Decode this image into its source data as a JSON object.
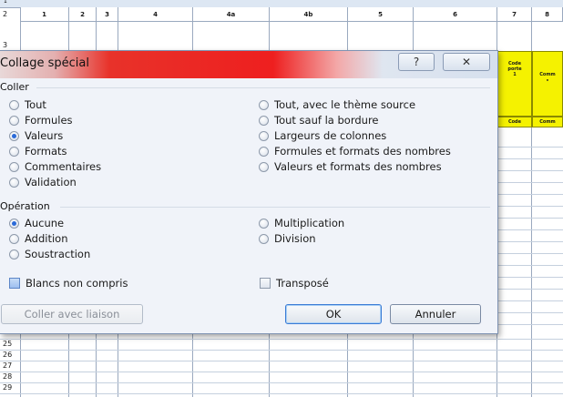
{
  "sheet": {
    "top_row_number": "1",
    "row_numbers_top": [
      "2",
      "3"
    ],
    "column_headers": [
      "1",
      "2",
      "3",
      "4",
      "4a",
      "4b",
      "5",
      "6",
      "7",
      "8"
    ],
    "row_numbers_bottom": [
      "25",
      "26",
      "27",
      "28",
      "29"
    ],
    "yellow_cells": [
      "Code\nporte\n1",
      "Comm\n•",
      "Code",
      "Comm"
    ]
  },
  "dialog": {
    "title": "Collage spécial",
    "help_button": "?",
    "close_button": "✕",
    "paste_section": {
      "label": "Coller",
      "left_options": [
        {
          "label": "Tout",
          "selected": false
        },
        {
          "label": "Formules",
          "selected": false
        },
        {
          "label": "Valeurs",
          "selected": true
        },
        {
          "label": "Formats",
          "selected": false
        },
        {
          "label": "Commentaires",
          "selected": false
        },
        {
          "label": "Validation",
          "selected": false
        }
      ],
      "right_options": [
        {
          "label": "Tout, avec le thème source",
          "selected": false
        },
        {
          "label": "Tout sauf la bordure",
          "selected": false
        },
        {
          "label": "Largeurs de colonnes",
          "selected": false
        },
        {
          "label": "Formules et formats des nombres",
          "selected": false
        },
        {
          "label": "Valeurs et formats des nombres",
          "selected": false
        }
      ]
    },
    "operation_section": {
      "label": "Opération",
      "left_options": [
        {
          "label": "Aucune",
          "selected": true
        },
        {
          "label": "Addition",
          "selected": false
        },
        {
          "label": "Soustraction",
          "selected": false
        }
      ],
      "right_options": [
        {
          "label": "Multiplication",
          "selected": false
        },
        {
          "label": "Division",
          "selected": false
        }
      ]
    },
    "checkboxes": {
      "skip_blanks": {
        "label": "Blancs non compris",
        "checked": false
      },
      "transpose": {
        "label": "Transposé",
        "checked": false
      }
    },
    "buttons": {
      "paste_link": "Coller avec liaison",
      "ok": "OK",
      "cancel": "Annuler"
    }
  }
}
